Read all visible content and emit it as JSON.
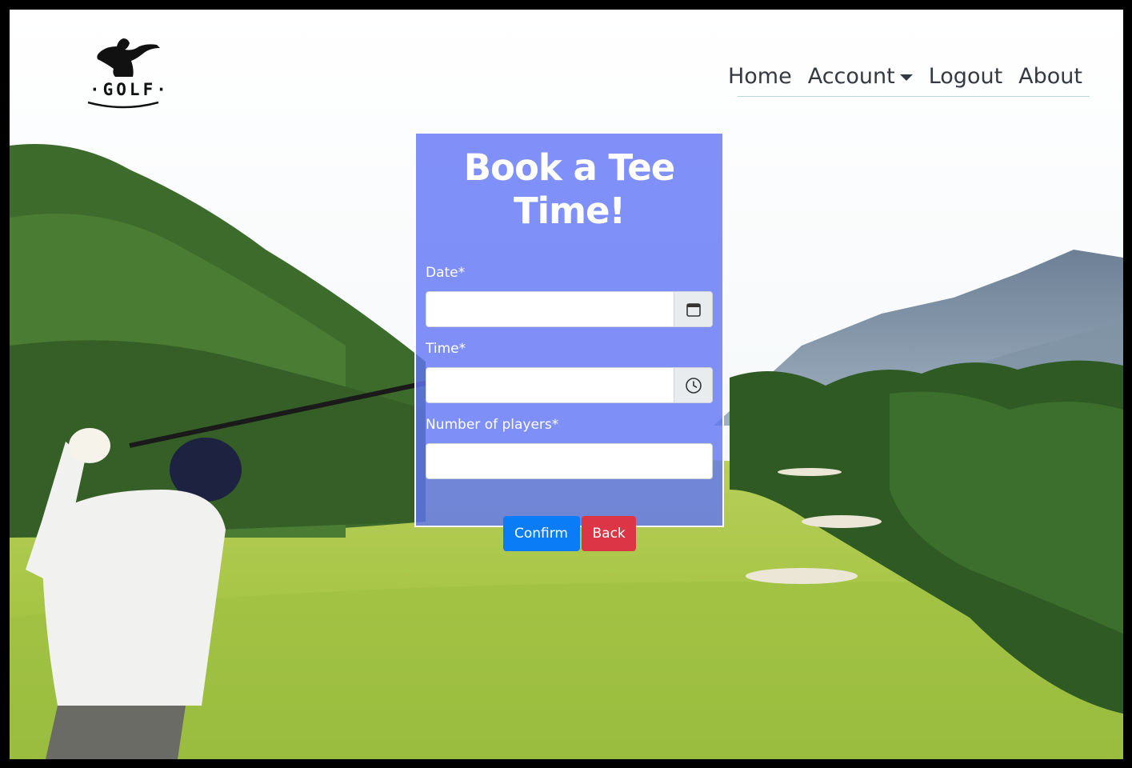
{
  "nav": {
    "items": [
      {
        "label": "Home"
      },
      {
        "label": "Account"
      },
      {
        "label": "Logout"
      },
      {
        "label": "About"
      }
    ]
  },
  "logo": {
    "text": "·GOLF·"
  },
  "form": {
    "title": "Book a Tee Time!",
    "date_label": "Date*",
    "date_value": "",
    "time_label": "Time*",
    "time_value": "",
    "players_label": "Number of players*",
    "players_value": "",
    "confirm_label": "Confirm",
    "back_label": "Back"
  },
  "icons": {
    "date_addon": "calendar-icon",
    "time_addon": "clock-icon"
  },
  "colors": {
    "card_bg": "#6074f6",
    "confirm": "#0a7cf5",
    "back": "#dc3545",
    "nav_text": "#343a40"
  }
}
